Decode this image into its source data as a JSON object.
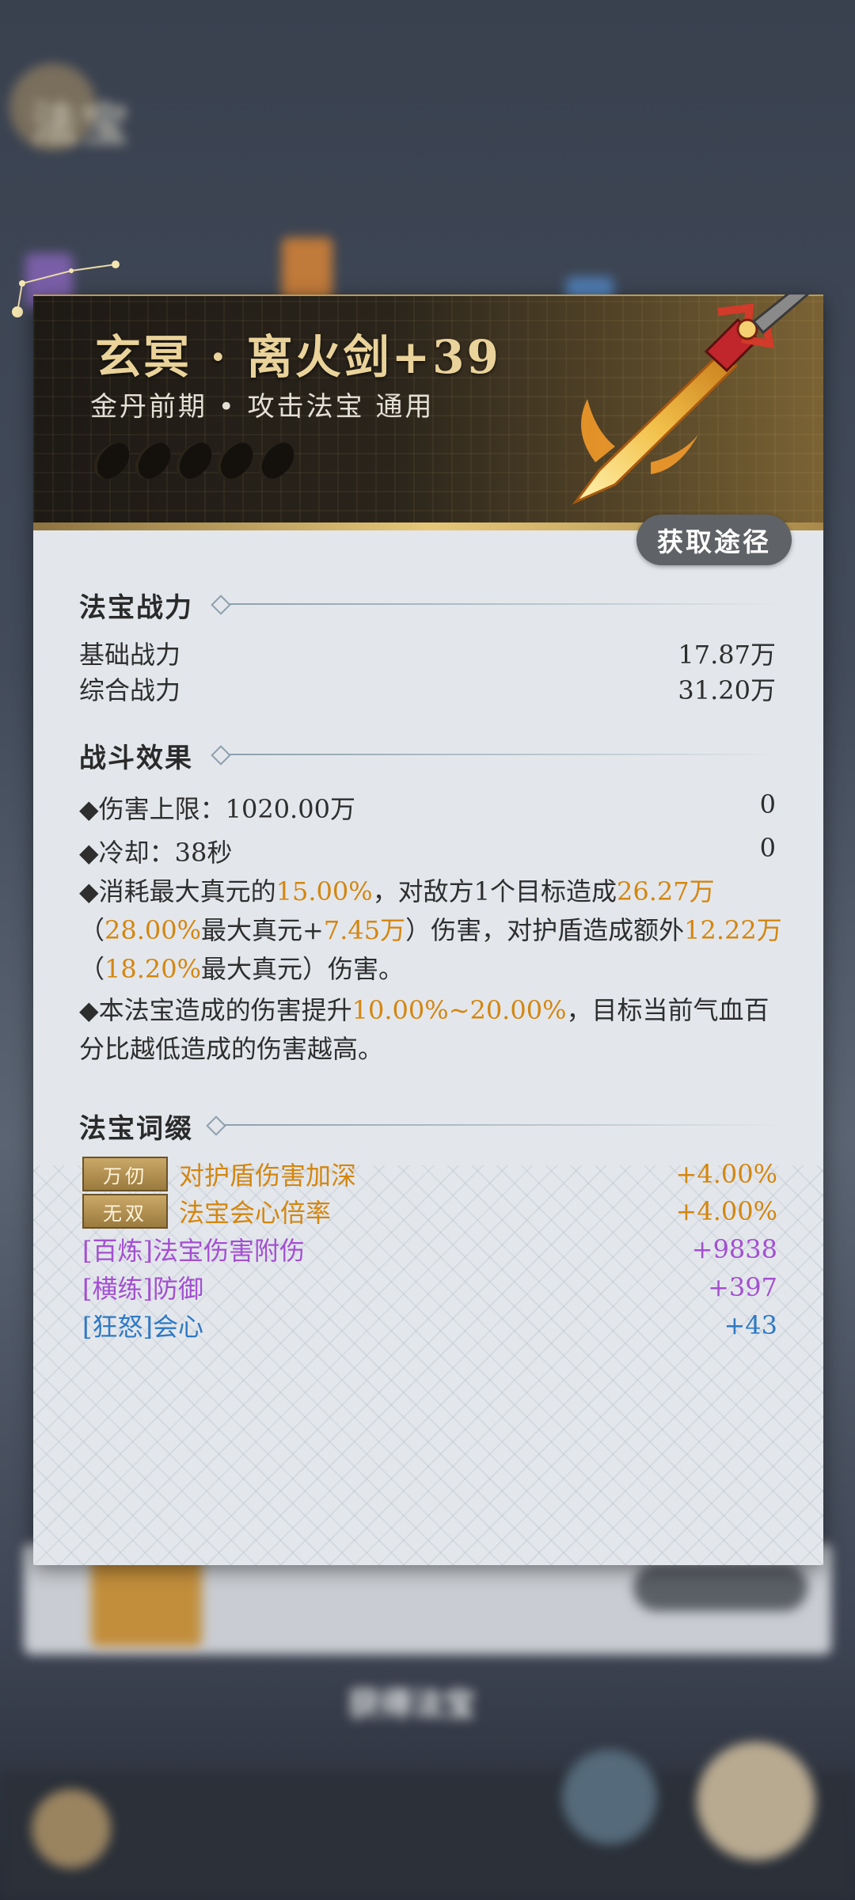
{
  "background": {
    "title": "法宝",
    "lower_title": "获得法宝"
  },
  "item": {
    "name": "玄冥 · 离火剑+39",
    "subtitle": "金丹前期 • 攻击法宝 通用",
    "star_count": 5,
    "source_button": "获取途径"
  },
  "power": {
    "title": "法宝战力",
    "rows": [
      {
        "label": "基础战力",
        "value": "17.87万"
      },
      {
        "label": "综合战力",
        "value": "31.20万"
      }
    ]
  },
  "combat": {
    "title": "战斗效果",
    "rows": [
      {
        "label": "◆伤害上限：1020.00万",
        "value": "0"
      },
      {
        "label": "◆冷却：38秒",
        "value": "0"
      }
    ],
    "effect1": {
      "p1": "◆消耗最大真元的",
      "h1": "15.00%",
      "p2": "，对敌方1个目标造成",
      "h2": "26.27万",
      "p3": "（",
      "h3": "28.00%",
      "p4": "最大真元+",
      "h4": "7.45万",
      "p5": "）伤害，对护盾造成额外",
      "h5": "12.22万",
      "p6": "（",
      "h6": "18.20%",
      "p7": "最大真元）伤害。"
    },
    "effect2": {
      "p1": "◆本法宝造成的伤害提升",
      "h1": "10.00%~20.00%",
      "p2": "，目标当前气血百分比越低造成的伤害越高。"
    }
  },
  "affixes": {
    "title": "法宝词缀",
    "items": [
      {
        "badge": "万仞",
        "label": "对护盾伤害加深",
        "value": "+4.00%"
      },
      {
        "badge": "无双",
        "label": "法宝会心倍率",
        "value": "+4.00%"
      },
      {
        "label": "[百炼]法宝伤害附伤",
        "value": "+9838"
      },
      {
        "label": "[横练]防御",
        "value": "+397"
      },
      {
        "label": "[狂怒]会心",
        "value": "+43"
      }
    ]
  },
  "colors": {
    "highlight": "#d4860f",
    "affix_gold": "#d4860f",
    "affix_purple": "#a34fd1",
    "affix_blue": "#2e79c4",
    "title_gold": "#ead39a"
  }
}
